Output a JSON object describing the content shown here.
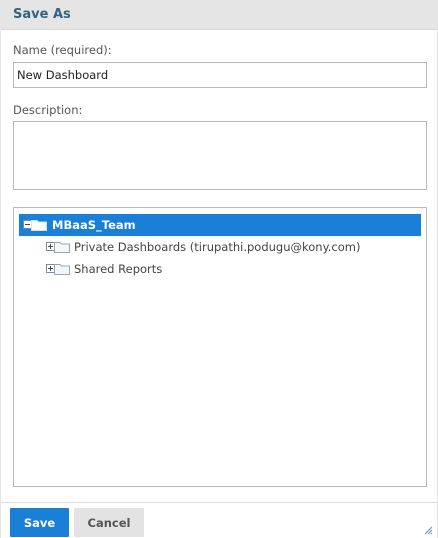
{
  "dialog": {
    "title": "Save As"
  },
  "name_field": {
    "label": "Name (required):",
    "value": "New Dashboard"
  },
  "description_field": {
    "label": "Description:",
    "value": ""
  },
  "tree": {
    "items": [
      {
        "label": "MBaaS_Team",
        "level": 0,
        "expanded": true,
        "selected": true
      },
      {
        "label": "Private Dashboards (tirupathi.podugu@kony.com)",
        "level": 1,
        "expanded": false,
        "selected": false
      },
      {
        "label": "Shared Reports",
        "level": 1,
        "expanded": false,
        "selected": false
      }
    ]
  },
  "buttons": {
    "save_label": "Save",
    "cancel_label": "Cancel"
  },
  "colors": {
    "accent": "#1a7fd6",
    "title": "#34627f",
    "titlebar_bg": "#e5e5e5"
  },
  "icons": {
    "collapse": "minus-box-icon",
    "expand": "plus-box-icon",
    "folder": "folder-icon",
    "resize": "resize-grip-icon"
  }
}
